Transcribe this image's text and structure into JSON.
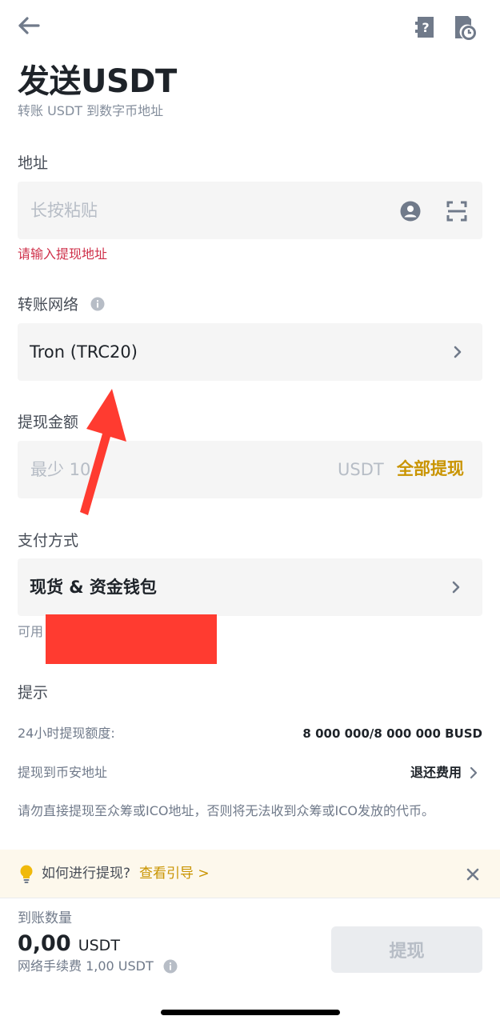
{
  "header": {
    "title": "发送USDT",
    "subtitle": "转账 USDT 到数字币地址"
  },
  "address": {
    "label": "地址",
    "placeholder": "长按粘贴",
    "error": "请输入提现地址"
  },
  "network": {
    "label": "转账网络",
    "value": "Tron (TRC20)"
  },
  "amount": {
    "label": "提现金额",
    "placeholder": "最少 10",
    "currency": "USDT",
    "withdraw_all": "全部提现"
  },
  "payment": {
    "label": "支付方式",
    "value": "现货 & 资金钱包",
    "available_label": "可用"
  },
  "tips": {
    "title": "提示",
    "limit_label": "24小时提现额度:",
    "limit_value": "8 000 000/8 000 000 BUSD",
    "binance_address_label": "提现到币安地址",
    "refund_label": "退还费用",
    "warning": "请勿直接提现至众筹或ICO地址，否则将无法收到众筹或ICO发放的代币。"
  },
  "banner": {
    "question": "如何进行提现?",
    "guide_link": "查看引导 >"
  },
  "footer": {
    "receive_label": "到账数量",
    "receive_amount": "0,00",
    "receive_currency": "USDT",
    "fee_text": "网络手续费 1,00 USDT",
    "withdraw_button": "提现"
  },
  "colors": {
    "accent": "#c99400",
    "error": "#cf304a",
    "arrow_annotation": "#ff3b30",
    "redaction": "#ff3b30"
  }
}
